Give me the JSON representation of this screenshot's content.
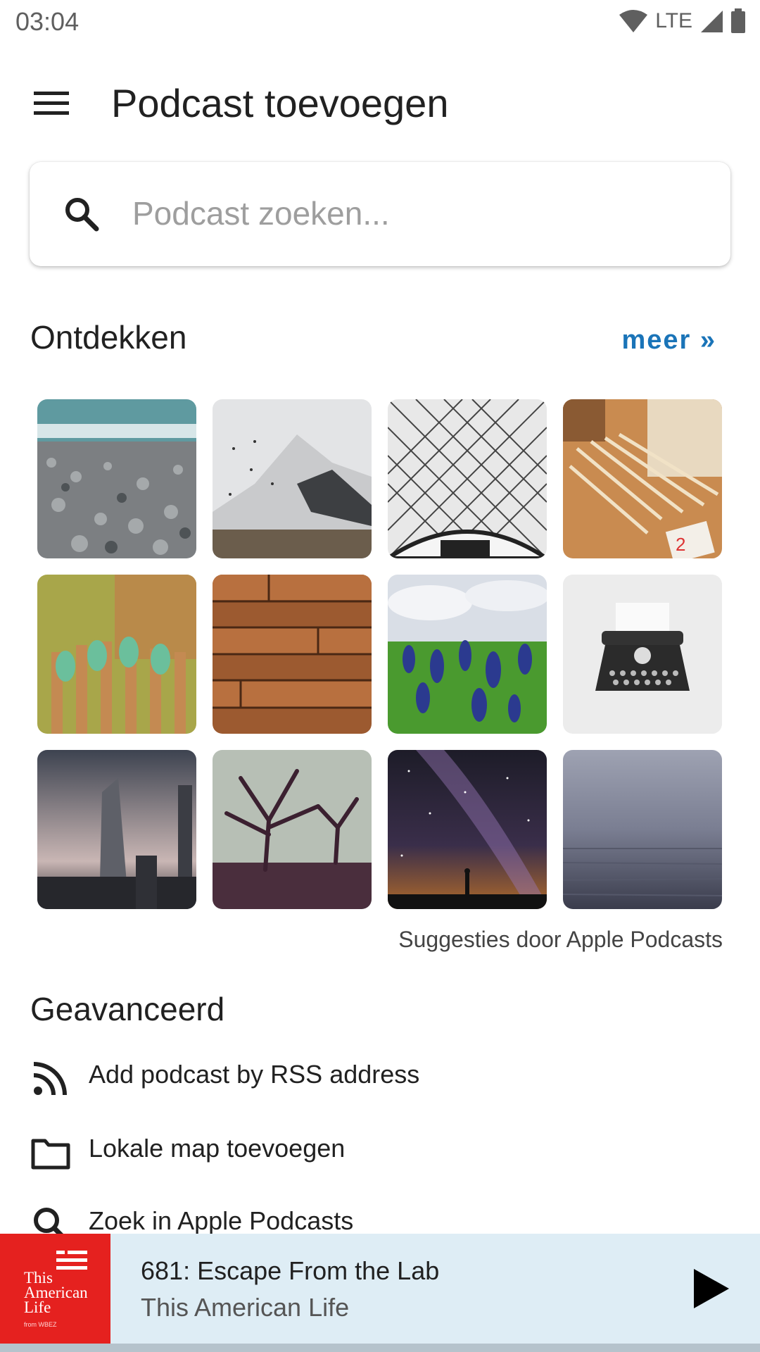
{
  "status_bar": {
    "time": "03:04",
    "network": "LTE"
  },
  "app_bar": {
    "title": "Podcast toevoegen"
  },
  "search": {
    "placeholder": "Podcast zoeken..."
  },
  "discover": {
    "heading": "Ontdekken",
    "more_label": "meer »",
    "attribution": "Suggesties door Apple Podcasts",
    "tiles": [
      "pebble-beach",
      "snowy-mountain",
      "glass-dome",
      "pencils-on-desk",
      "green-bottles-fence",
      "wood-planks",
      "bluebonnet-field",
      "typewriter",
      "skyscraper-dusk",
      "misty-trees",
      "milky-way",
      "grey-sea"
    ]
  },
  "advanced": {
    "heading": "Geavanceerd",
    "items": [
      {
        "icon": "rss-icon",
        "label": "Add podcast by RSS address"
      },
      {
        "icon": "folder-icon",
        "label": "Lokale map toevoegen"
      },
      {
        "icon": "search-icon",
        "label": "Zoek in Apple Podcasts"
      }
    ]
  },
  "player": {
    "episode_title": "681: Escape From the Lab",
    "podcast_name": "This American Life",
    "artwork_text": "This American Life",
    "artwork_subtext": "from WBEZ",
    "artwork_color": "#e5211f"
  },
  "colors": {
    "accent": "#1a74b8",
    "player_bg": "#deedf5"
  }
}
